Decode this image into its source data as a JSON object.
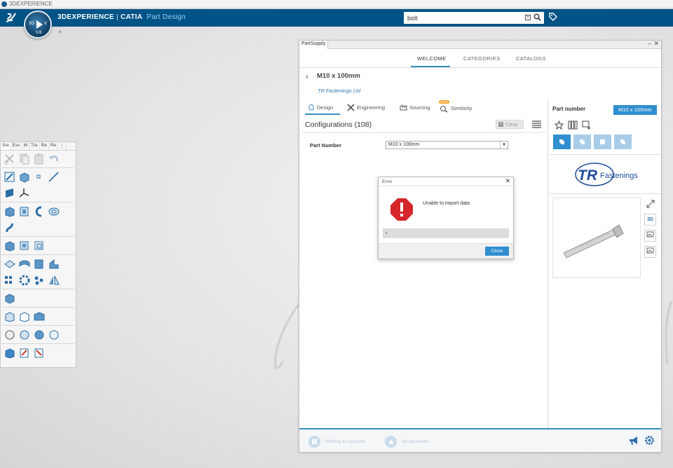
{
  "os": {
    "title": "3DEXPERIENCE"
  },
  "topbar": {
    "brand": "3DEXPERIENCE",
    "app": "CATIA",
    "app_sub": "Part Design",
    "compass_label": "V.6",
    "search_value": "bolt",
    "plus_label": "+"
  },
  "toolbar": {
    "tabs": [
      "Sta",
      "Ess",
      "M",
      "Tra",
      "Re",
      "Re",
      "⋮"
    ]
  },
  "partsupply": {
    "window_title": "PartSupply",
    "nav": [
      "WELCOME",
      "CATEGORIES",
      "CATALOGS"
    ],
    "part_title": "M10 x 100mm",
    "vendor": "TR Fastenings Ltd",
    "subtabs": [
      "Design",
      "Engineering",
      "Sourcing",
      "Similarity"
    ],
    "similarity_badge": "NEW",
    "configurations": "Configurations (108)",
    "clear_label": "Clear",
    "part_number_label": "Part Number",
    "part_number_value": "M10 x 100mm",
    "right": {
      "label": "Part number",
      "badge": "M10 x 100mm",
      "logo_initials": "TR",
      "logo_text": "Fastenings",
      "view_3d": "3D"
    },
    "footer": {
      "compare": "Nothing to compare",
      "bookmark": "No bookmark"
    }
  },
  "error_dialog": {
    "title": "Error",
    "message": "Unable to import data",
    "details_marker": "▸",
    "close_label": "Close"
  },
  "colors": {
    "topbar": "#005386",
    "accent": "#2f8fd0",
    "error": "#d4262b"
  }
}
